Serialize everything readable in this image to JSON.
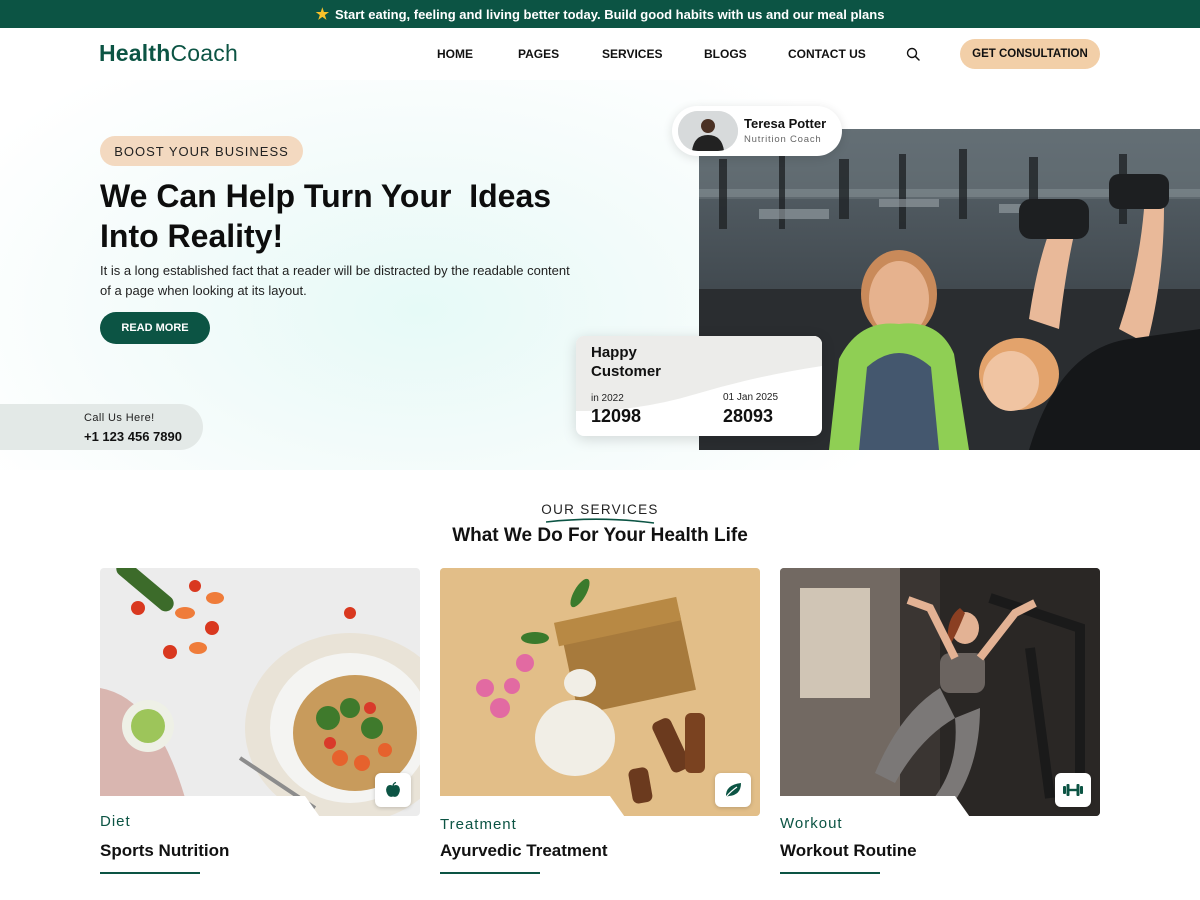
{
  "announcement": {
    "text": "Start eating, feeling and living better today. Build good habits with us and our meal plans"
  },
  "brand": {
    "part1": "Health",
    "part2": "Coach"
  },
  "nav": {
    "home": "HOME",
    "pages": "PAGES",
    "services": "SERVICES",
    "blogs": "BLOGS",
    "contact": "CONTACT US"
  },
  "header": {
    "cta": "GET CONSULTATION"
  },
  "hero": {
    "badge": "BOOST YOUR BUSINESS",
    "title_line1": "We Can Help Turn Your  Ideas",
    "title_line2": "Into Reality!",
    "description": "It is a long established fact that a reader will be distracted by the readable content of a page when looking at its layout.",
    "button": "READ MORE",
    "call_label": "Call Us Here!",
    "call_number": "+1 123 456 7890"
  },
  "coach": {
    "name": "Teresa Potter",
    "role": "Nutrition Coach"
  },
  "happy": {
    "title": "Happy Customer",
    "stat1_label": "in 2022",
    "stat1_value": "12098",
    "stat2_label": "01 Jan 2025",
    "stat2_value": "28093"
  },
  "services": {
    "eyebrow": "OUR SERVICES",
    "title": "What We Do For Your Health Life",
    "cards": [
      {
        "category": "Diet",
        "name": "Sports Nutrition",
        "icon": "apple-icon"
      },
      {
        "category": "Treatment",
        "name": "Ayurvedic Treatment",
        "icon": "leaf-icon"
      },
      {
        "category": "Workout",
        "name": "Workout Routine",
        "icon": "dumbbell-icon"
      }
    ]
  },
  "colors": {
    "brand_green": "#0c5444",
    "accent_peach": "#f2cfa8",
    "badge_peach": "#f3d9c0"
  }
}
